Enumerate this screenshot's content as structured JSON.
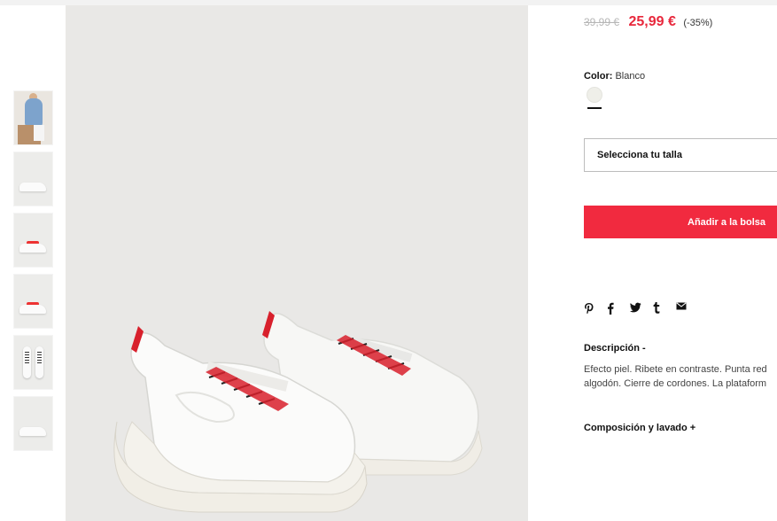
{
  "product": {
    "price_old": "39,99 €",
    "price_new": "25,99 €",
    "discount": "(-35%)",
    "color_label": "Color:",
    "color_value": "Blanco",
    "size_placeholder": "Selecciona tu talla",
    "add_to_bag": "Añadir a la bolsa"
  },
  "share_icons": [
    "pinterest-icon",
    "facebook-icon",
    "twitter-icon",
    "tumblr-icon",
    "email-icon"
  ],
  "description": {
    "title": "Descripción -",
    "line1": "Efecto piel. Ribete en contraste. Punta red",
    "line2": "algodón. Cierre de cordones. La plataform"
  },
  "composition": {
    "title": "Composición y lavado +"
  },
  "thumbnails": [
    "model-photo",
    "side-view",
    "pair-view",
    "detail-view",
    "top-view",
    "back-view"
  ],
  "colors": {
    "accent": "#f12a3f",
    "price_red": "#e8283c",
    "photo_bg": "#e9e8e6"
  }
}
